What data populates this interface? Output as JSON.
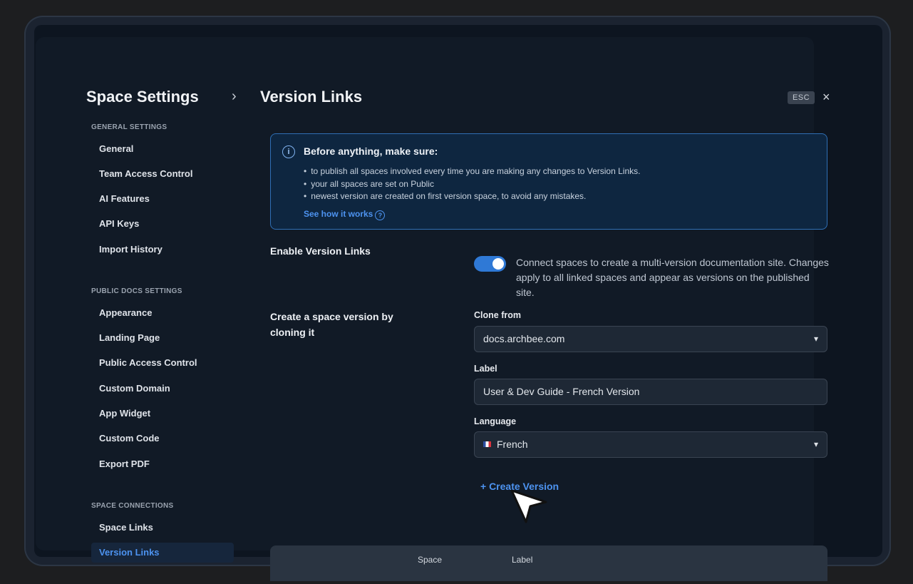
{
  "header": {
    "title": "Space Settings",
    "breadcrumb_separator": "›",
    "page_title": "Version Links",
    "esc_label": "ESC",
    "close_label": "×"
  },
  "sidebar": {
    "sections": [
      {
        "title": "GENERAL SETTINGS",
        "items": [
          "General",
          "Team Access Control",
          "AI Features",
          "API Keys",
          "Import History"
        ]
      },
      {
        "title": "PUBLIC DOCS SETTINGS",
        "items": [
          "Appearance",
          "Landing Page",
          "Public Access Control",
          "Custom Domain",
          "App Widget",
          "Custom Code",
          "Export PDF"
        ]
      },
      {
        "title": "SPACE CONNECTIONS",
        "items": [
          "Space Links",
          "Version Links"
        ]
      }
    ],
    "active_item": "Version Links"
  },
  "info": {
    "icon": "info-icon",
    "title": "Before anything, make sure:",
    "bullets": [
      "to publish all spaces involved every time you are making any changes to Version Links.",
      "your all spaces are set on Public",
      "newest version are created on first version space, to avoid any mistakes."
    ],
    "link": "See how it works"
  },
  "enable": {
    "label": "Enable Version Links",
    "toggle_on": true,
    "description": "Connect spaces to create a multi-version documentation site. Changes apply to all linked spaces and appear as versions on the published site."
  },
  "clone": {
    "label": "Create a space version by cloning it",
    "clone_from_label": "Clone from",
    "clone_from_value": "docs.archbee.com",
    "label_label": "Label",
    "label_value": "User & Dev Guide - French Version",
    "language_label": "Language",
    "language_value": "French",
    "create_button": "+ Create Version"
  },
  "table": {
    "columns": [
      "Space",
      "Label"
    ]
  },
  "colors": {
    "accent": "#2f79d6",
    "link": "#4d93f0",
    "background": "#0d1520"
  }
}
